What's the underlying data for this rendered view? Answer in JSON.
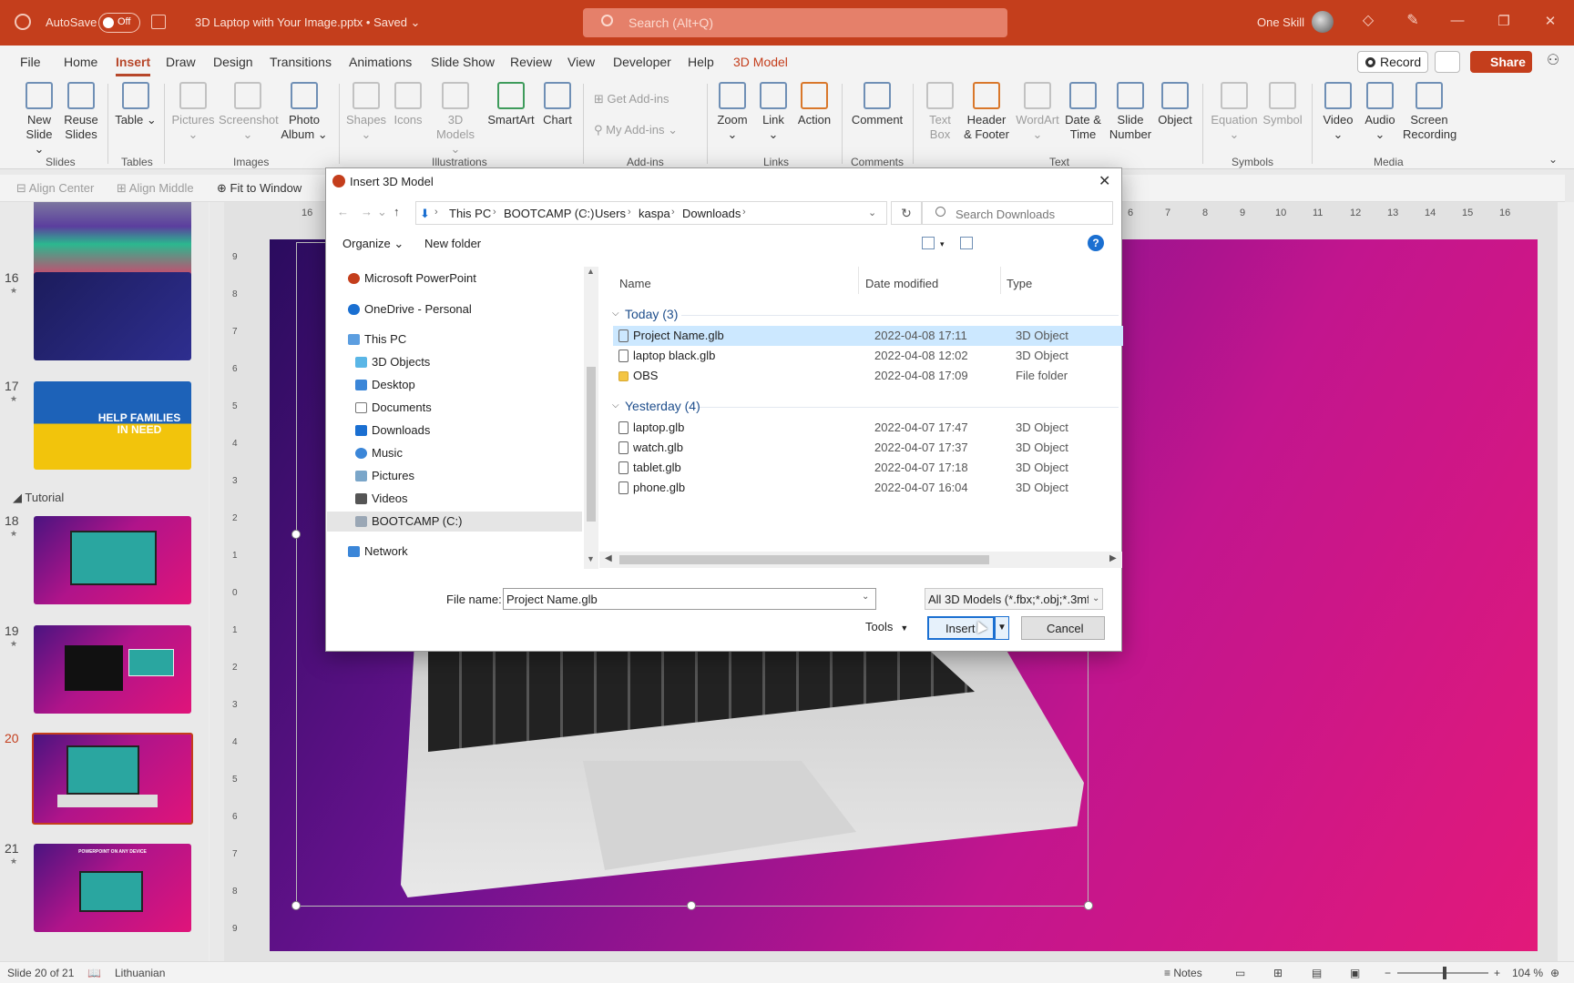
{
  "titlebar": {
    "autosave_label": "AutoSave",
    "autosave_state": "Off",
    "document_title": "3D Laptop with Your Image.pptx • Saved ⌄",
    "search_placeholder": "Search (Alt+Q)",
    "user_name": "One Skill"
  },
  "menu": {
    "tabs": [
      "File",
      "Home",
      "Insert",
      "Draw",
      "Design",
      "Transitions",
      "Animations",
      "Slide Show",
      "Review",
      "View",
      "Developer",
      "Help",
      "3D Model"
    ],
    "active_tab": "Insert",
    "record_label": "Record",
    "share_label": "Share"
  },
  "ribbon": {
    "buttons": {
      "new_slide": "New Slide ⌄",
      "reuse_slides": "Reuse Slides",
      "table": "Table ⌄",
      "pictures": "Pictures ⌄",
      "screenshot": "Screenshot ⌄",
      "photo_album": "Photo Album ⌄",
      "shapes": "Shapes ⌄",
      "icons": "Icons",
      "models_3d": "3D Models ⌄",
      "smartart": "SmartArt",
      "chart": "Chart",
      "get_addins": "Get Add-ins",
      "my_addins": "My Add-ins",
      "zoom": "Zoom ⌄",
      "link": "Link ⌄",
      "action": "Action",
      "comment": "Comment",
      "text_box": "Text Box",
      "header_footer": "Header & Footer",
      "wordart": "WordArt ⌄",
      "date_time": "Date & Time",
      "slide_number": "Slide Number",
      "object": "Object",
      "equation": "Equation ⌄",
      "symbol": "Symbol",
      "video": "Video ⌄",
      "audio": "Audio ⌄",
      "screen_recording": "Screen Recording"
    },
    "groups": [
      "Slides",
      "Tables",
      "Images",
      "Illustrations",
      "Add-ins",
      "Links",
      "Comments",
      "Text",
      "Symbols",
      "Media"
    ]
  },
  "subtoolbar": {
    "align_center": "Align Center",
    "align_middle": "Align Middle",
    "fit_to_window": "Fit to Window"
  },
  "thumbnails": {
    "section_title": "Tutorial",
    "slides": [
      "16",
      "17",
      "18",
      "19",
      "20",
      "21"
    ],
    "current": "20",
    "slide17_text": "HELP FAMILIES IN NEED",
    "slide21_text": "POWERPOINT ON ANY DEVICE"
  },
  "ruler": {
    "top": [
      "16",
      "6",
      "7",
      "8",
      "9",
      "10",
      "11",
      "12",
      "13",
      "14",
      "15",
      "16"
    ],
    "left": [
      "9",
      "8",
      "7",
      "6",
      "5",
      "4",
      "3",
      "2",
      "1",
      "0",
      "1",
      "2",
      "3",
      "4",
      "5",
      "6",
      "7",
      "8",
      "9"
    ]
  },
  "dialog": {
    "title": "Insert 3D Model",
    "breadcrumb": [
      "This PC",
      "BOOTCAMP (C:)",
      "Users",
      "kaspa",
      "Downloads"
    ],
    "search_placeholder": "Search Downloads",
    "organize_label": "Organize ⌄",
    "new_folder_label": "New folder",
    "nav_items": [
      {
        "label": "Microsoft PowerPoint",
        "icon": "powerpoint-icon"
      },
      {
        "label": "OneDrive - Personal",
        "icon": "cloud-icon"
      },
      {
        "label": "This PC",
        "icon": "computer-icon"
      },
      {
        "label": "3D Objects",
        "icon": "cube-icon"
      },
      {
        "label": "Desktop",
        "icon": "desktop-icon"
      },
      {
        "label": "Documents",
        "icon": "document-icon"
      },
      {
        "label": "Downloads",
        "icon": "download-icon"
      },
      {
        "label": "Music",
        "icon": "music-icon"
      },
      {
        "label": "Pictures",
        "icon": "picture-icon"
      },
      {
        "label": "Videos",
        "icon": "video-icon"
      },
      {
        "label": "BOOTCAMP (C:)",
        "icon": "drive-icon"
      },
      {
        "label": "Network",
        "icon": "network-icon"
      }
    ],
    "columns": {
      "name": "Name",
      "date": "Date modified",
      "type": "Type"
    },
    "groups": [
      {
        "label": "Today (3)",
        "files": [
          {
            "name": "Project Name.glb",
            "date": "2022-04-08 17:11",
            "type": "3D Object"
          },
          {
            "name": "laptop black.glb",
            "date": "2022-04-08 12:02",
            "type": "3D Object"
          },
          {
            "name": "OBS",
            "date": "2022-04-08 17:09",
            "type": "File folder"
          }
        ]
      },
      {
        "label": "Yesterday (4)",
        "files": [
          {
            "name": "laptop.glb",
            "date": "2022-04-07 17:47",
            "type": "3D Object"
          },
          {
            "name": "watch.glb",
            "date": "2022-04-07 17:37",
            "type": "3D Object"
          },
          {
            "name": "tablet.glb",
            "date": "2022-04-07 17:18",
            "type": "3D Object"
          },
          {
            "name": "phone.glb",
            "date": "2022-04-07 16:04",
            "type": "3D Object"
          }
        ]
      }
    ],
    "file_name_label": "File name:",
    "file_name_value": "Project Name.glb",
    "filter_value": "All 3D Models (*.fbx;*.obj;*.3mf;",
    "tools_label": "Tools",
    "insert_label": "Insert",
    "cancel_label": "Cancel"
  },
  "statusbar": {
    "slide_info": "Slide 20 of 21",
    "language": "Lithuanian",
    "notes": "Notes",
    "zoom": "104 %"
  }
}
